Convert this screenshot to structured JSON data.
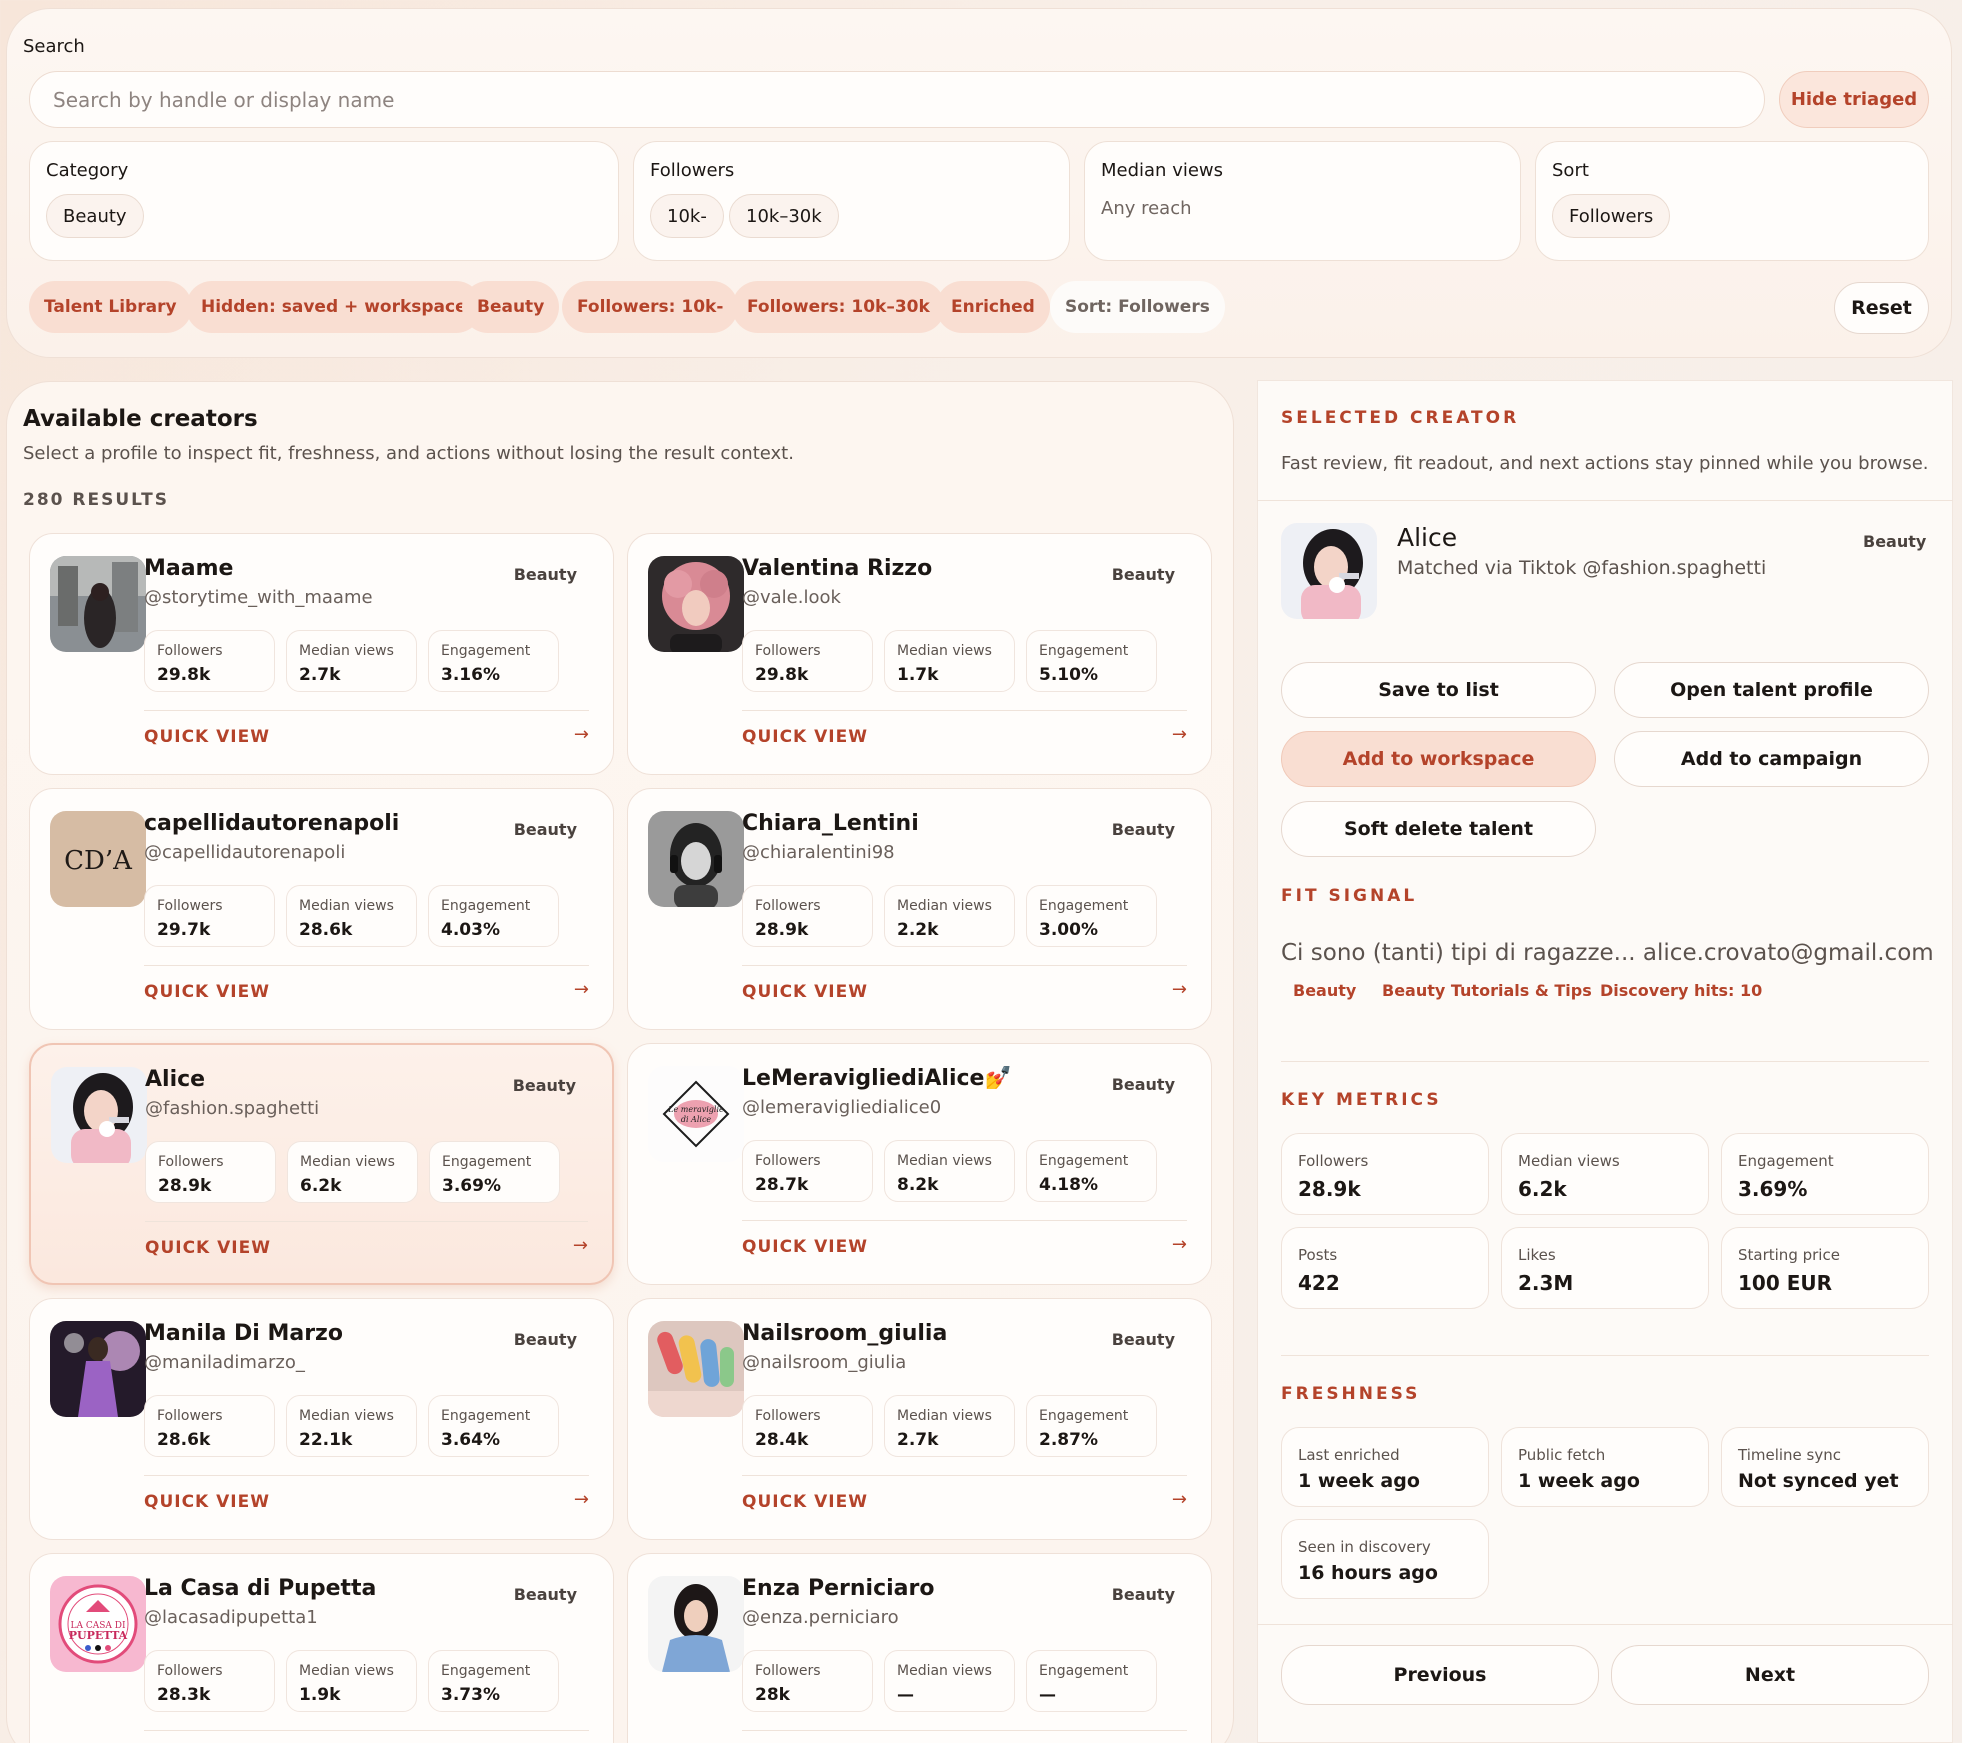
{
  "search": {
    "label": "Search",
    "placeholder": "Search by handle or display name",
    "hide_triaged": "Hide triaged"
  },
  "filters": {
    "category": {
      "title": "Category",
      "options": [
        "Beauty"
      ]
    },
    "followers": {
      "title": "Followers",
      "options": [
        "10k-",
        "10k–30k"
      ]
    },
    "median_views": {
      "title": "Median views",
      "value": "Any reach"
    },
    "sort": {
      "title": "Sort",
      "options": [
        "Followers"
      ]
    }
  },
  "active_tags": [
    "Talent Library",
    "Hidden: saved + workspace",
    "Beauty",
    "Followers: 10k-",
    "Followers: 10k–30k",
    "Enriched",
    "Sort: Followers"
  ],
  "reset_label": "Reset",
  "results": {
    "title": "Available creators",
    "subtitle": "Select a profile to inspect fit, freshness, and actions without losing the result context.",
    "count": "280 RESULTS",
    "metric_labels": {
      "followers": "Followers",
      "median_views": "Median views",
      "engagement": "Engagement"
    },
    "quick_view": "QUICK VIEW",
    "arrow": "→",
    "creators": [
      {
        "name": "Maame",
        "handle": "@storytime_with_maame",
        "category": "Beauty",
        "followers": "29.8k",
        "median_views": "2.7k",
        "engagement": "3.16%",
        "avatar": "photo-street"
      },
      {
        "name": "Valentina Rizzo",
        "handle": "@vale.look",
        "category": "Beauty",
        "followers": "29.8k",
        "median_views": "1.7k",
        "engagement": "5.10%",
        "avatar": "photo-pink-curls"
      },
      {
        "name": "capellidautorenapoli",
        "handle": "@capellidautorenapoli",
        "category": "Beauty",
        "followers": "29.7k",
        "median_views": "28.6k",
        "engagement": "4.03%",
        "avatar": "logo-cda",
        "avatar_text": "CD’A"
      },
      {
        "name": "Chiara_Lentini",
        "handle": "@chiaralentini98",
        "category": "Beauty",
        "followers": "28.9k",
        "median_views": "2.2k",
        "engagement": "3.00%",
        "avatar": "photo-bw-headphones"
      },
      {
        "name": "Alice",
        "handle": "@fashion.spaghetti",
        "category": "Beauty",
        "followers": "28.9k",
        "median_views": "6.2k",
        "engagement": "3.69%",
        "avatar": "photo-alice",
        "selected": true
      },
      {
        "name": "LeMeravigliediAlice💅",
        "handle": "@lemeravigliedialice0",
        "category": "Beauty",
        "followers": "28.7k",
        "median_views": "8.2k",
        "engagement": "4.18%",
        "avatar": "logo-diamond"
      },
      {
        "name": "Manila Di Marzo",
        "handle": "@maniladimarzo_",
        "category": "Beauty",
        "followers": "28.6k",
        "median_views": "22.1k",
        "engagement": "3.64%",
        "avatar": "photo-purple-dress"
      },
      {
        "name": "Nailsroom_giulia",
        "handle": "@nailsroom_giulia",
        "category": "Beauty",
        "followers": "28.4k",
        "median_views": "2.7k",
        "engagement": "2.87%",
        "avatar": "photo-nails"
      },
      {
        "name": "La Casa di Pupetta",
        "handle": "@lacasadipupetta1",
        "category": "Beauty",
        "followers": "28.3k",
        "median_views": "1.9k",
        "engagement": "3.73%",
        "avatar": "logo-pupetta"
      },
      {
        "name": "Enza Perniciaro",
        "handle": "@enza.perniciaro",
        "category": "Beauty",
        "followers": "28k",
        "median_views": "—",
        "engagement": "—",
        "avatar": "photo-blue-top"
      }
    ]
  },
  "detail": {
    "section_title": "SELECTED CREATOR",
    "section_sub": "Fast review, fit readout, and next actions stay pinned while you browse.",
    "name": "Alice",
    "matched": "Matched via Tiktok @fashion.spaghetti",
    "category": "Beauty",
    "actions": {
      "save": "Save to list",
      "open": "Open talent profile",
      "workspace": "Add to workspace",
      "campaign": "Add to campaign",
      "delete": "Soft delete talent"
    },
    "fit_title": "FIT SIGNAL",
    "fit_text": "Ci sono (tanti) tipi di ragazze... alice.crovato@gmail.com",
    "fit_tags": [
      "Beauty",
      "Beauty Tutorials & Tips",
      "Discovery hits: 10"
    ],
    "metrics_title": "KEY METRICS",
    "metrics": [
      {
        "label": "Followers",
        "value": "28.9k"
      },
      {
        "label": "Median views",
        "value": "6.2k"
      },
      {
        "label": "Engagement",
        "value": "3.69%"
      },
      {
        "label": "Posts",
        "value": "422"
      },
      {
        "label": "Likes",
        "value": "2.3M"
      },
      {
        "label": "Starting price",
        "value": "100 EUR"
      }
    ],
    "freshness_title": "FRESHNESS",
    "freshness": [
      {
        "label": "Last enriched",
        "value": "1 week ago"
      },
      {
        "label": "Public fetch",
        "value": "1 week ago"
      },
      {
        "label": "Timeline sync",
        "value": "Not synced yet"
      },
      {
        "label": "Seen in discovery",
        "value": "16 hours ago"
      }
    ],
    "prev": "Previous",
    "next": "Next"
  }
}
